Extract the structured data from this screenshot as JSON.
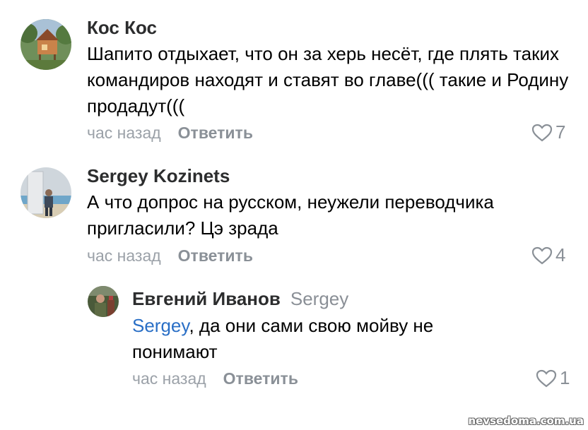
{
  "comments": [
    {
      "author": "Кос Кос",
      "text": "Шапито отдыхает, что он за херь несёт, где плять таких командиров находят и ставят во главе((( такие и Родину продадут(((",
      "time": "час назад",
      "reply_label": "Ответить",
      "likes": "7"
    },
    {
      "author": "Sergey Kozinets",
      "text": "А что допрос на русском, неужели переводчика пригласили? Цэ зрада",
      "time": "час назад",
      "reply_label": "Ответить",
      "likes": "4"
    },
    {
      "author": "Евгений Иванов",
      "reply_to": "Sergey",
      "mention": "Sergey",
      "text": ", да они сами свою мойву не понимают",
      "time": "час назад",
      "reply_label": "Ответить",
      "likes": "1"
    }
  ],
  "watermark": "nevsedoma.com.ua",
  "colors": {
    "mention": "#2a6fc6",
    "meta": "#9ba1a8",
    "author": "#2c2d2e"
  },
  "icons": {
    "like": "heart-outline-icon"
  }
}
